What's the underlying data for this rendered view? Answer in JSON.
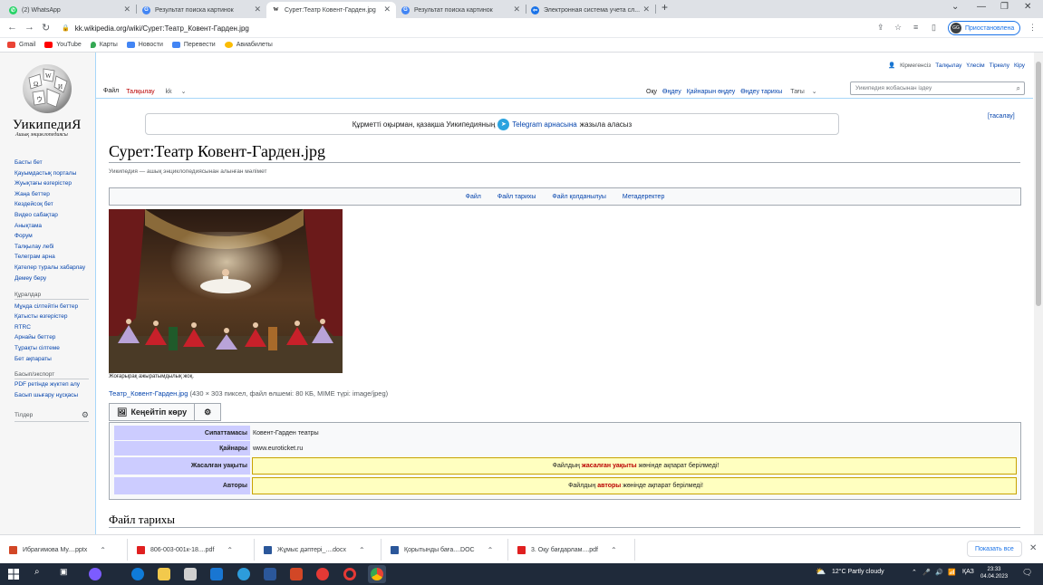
{
  "browser": {
    "tabs": [
      {
        "label": "(2) WhatsApp",
        "color": "#25d366"
      },
      {
        "label": "Результат поиска картинок",
        "color": "#4285f4"
      },
      {
        "label": "Сурет:Театр Ковент-Гарден.jpg",
        "color": "#000000"
      },
      {
        "label": "Результат поиска картинок",
        "color": "#4285f4"
      },
      {
        "label": "Электронная система учета сл...",
        "color": "#1a73e8"
      }
    ],
    "new_tab": "+",
    "url": "kk.wikipedia.org/wiki/Сурет:Театр_Ковент-Гарден.jpg",
    "profile_initials": "GG",
    "profile_status": "Приостановлена",
    "bookmarks": [
      {
        "label": "Gmail",
        "color": "#ea4335"
      },
      {
        "label": "YouTube",
        "color": "#ff0000"
      },
      {
        "label": "Карты",
        "color": "#34a853"
      },
      {
        "label": "Новости",
        "color": "#4285f4"
      },
      {
        "label": "Перевести",
        "color": "#4285f4"
      },
      {
        "label": "Авиабилеты",
        "color": "#fbbc04"
      }
    ]
  },
  "wiki": {
    "logo_word": "УикипедиЯ",
    "logo_sub": "Ашық энциклопедиясы",
    "sidebar_main": [
      "Басты бет",
      "Қауымдастық порталы",
      "Жуықтағы өзгерістер",
      "Жаңа беттер",
      "Кездейсоқ бет",
      "Видео сабақтар",
      "Анықтама",
      "Форум",
      "Талқылау лебі",
      "Телеграм арна",
      "Қателер туралы хабарлау",
      "Демеу беру"
    ],
    "tools_head": "Құралдар",
    "sidebar_tools": [
      "Мұнда сілтейтін беттер",
      "Қатысты өзгерістер",
      "RTRC",
      "Арнайы беттер",
      "Тұрақты сілтеме",
      "Бет ақпараты"
    ],
    "export_head": "Басып/экспорт",
    "sidebar_export": [
      "PDF ретінде жүктеп алу",
      "Басып шығару нұсқасы"
    ],
    "langs_head": "Тілдер",
    "personal": [
      "Кірмегенсіз",
      "Талқылау",
      "Үлесім",
      "Тіркелу",
      "Кіру"
    ],
    "left_tabs": {
      "file": "Файл",
      "talk": "Талқылау",
      "lang": "kk"
    },
    "right_tabs": {
      "read": "Оқу",
      "edit": "Өңдеу",
      "edit_source": "Қайнарын өңдеу",
      "history": "Өңдеу тарихы",
      "more": "Тағы"
    },
    "search_placeholder": "Уикипедия жобасынан іздеу",
    "notice": {
      "before": "Құрметті оқырман, қазақша Уикипедияның",
      "link": "Telegram арнасына",
      "after": "жазыла аласыз"
    },
    "hide": "[тасалау]",
    "title": "Сурет:Театр Ковент-Гарден.jpg",
    "subtitle": "Уикипедия — ашық энциклопедиясынан алынған мәлімет",
    "file_nav": [
      "Файл",
      "Файл тарихы",
      "Файл қолданылуы",
      "Метадеректер"
    ],
    "caption": "Жоғарырақ ажыратымдылық жоқ.",
    "file_link": "Театр_Ковент-Гарден.jpg",
    "file_meta": "(430 × 303 пиксел, файл өлшемі: 80 КБ, MIME түрі: image/jpeg)",
    "view_btn": "Кеңейтіп көру",
    "rows": [
      {
        "k": "Сипаттамасы",
        "v": "Ковент-Гарден театры"
      },
      {
        "k": "Қайнары",
        "v": "www.euroticket.ru"
      },
      {
        "k": "Жасалған уақыты",
        "pre": "Файлдың",
        "b": "жасалған уақыты",
        "post": "жөнінде ақпарат берілмеді!"
      },
      {
        "k": "Авторы",
        "pre": "Файлдың",
        "b": "авторы",
        "post": "жөнінде ақпарат берілмеді!"
      }
    ],
    "section": "Файл тарихы"
  },
  "downloads": [
    {
      "label": "Ибрагимова Му....pptx",
      "color": "#d24726"
    },
    {
      "label": "806-003-001к-18....pdf",
      "color": "#e02020"
    },
    {
      "label": "Жұмыс дәптері_....docx",
      "color": "#2b579a"
    },
    {
      "label": "Қорытынды бағa....DOC",
      "color": "#2b579a"
    },
    {
      "label": "3. Оқу бағдарлам....pdf",
      "color": "#e02020"
    }
  ],
  "show_all": "Показать все",
  "taskbar": {
    "weather": "12°C  Partly cloudy",
    "lang": "ҚАЗ",
    "time": "23:33",
    "date": "04.04.2023"
  }
}
